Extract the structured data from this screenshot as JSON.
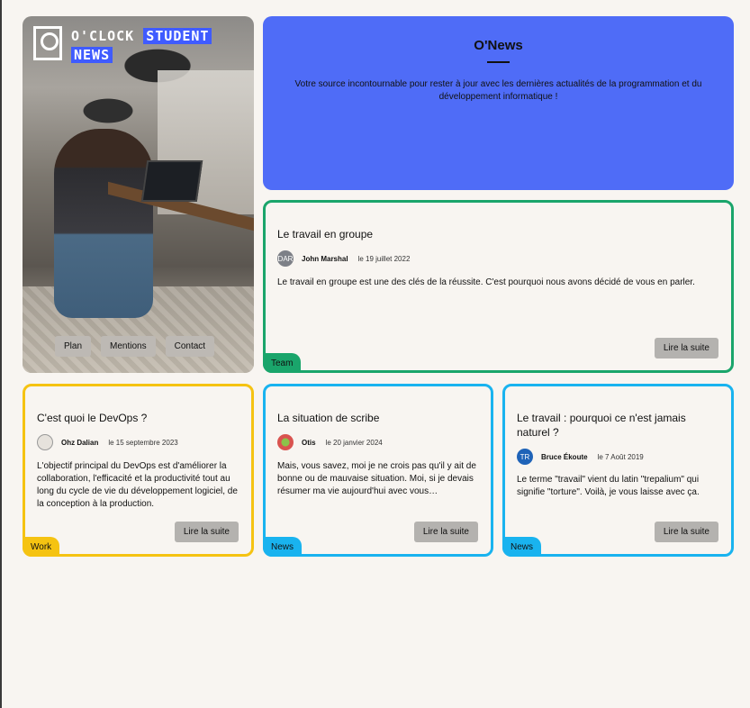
{
  "brand": {
    "line1_plain": "O'CLOCK",
    "line1_highlight": "STUDENT",
    "line2_highlight": "NEWS"
  },
  "nav": [
    "Plan",
    "Mentions",
    "Contact"
  ],
  "banner": {
    "title": "O'News",
    "description": "Votre source incontournable pour rester à jour avec les dernières actualités de la programmation et du développement informatique !"
  },
  "read_more_label": "Lire la suite",
  "colors": {
    "accent": "#4f6cf7",
    "team": "#1aa56b",
    "work": "#f5c312",
    "news": "#19b3ef"
  },
  "articles": [
    {
      "title": "Le travail en groupe",
      "avatar_initials": "DAR",
      "author": "John Marshal",
      "date": "le 19 juillet 2022",
      "excerpt": "Le travail en groupe est une des clés de la réussite. C'est pourquoi nous avons décidé de vous en parler.",
      "category": "Team"
    },
    {
      "title": "C'est quoi le DevOps ?",
      "avatar_initials": "",
      "author": "Ohz Dalian",
      "date": "le 15 septembre 2023",
      "excerpt": "L'objectif principal du DevOps est d'améliorer la collaboration, l'efficacité et la productivité tout au long du cycle de vie du développement logiciel, de la conception à la production.",
      "category": "Work"
    },
    {
      "title": "La situation de scribe",
      "avatar_initials": "",
      "author": "Otis",
      "date": "le 20 janvier 2024",
      "excerpt": "Mais, vous savez, moi je ne crois pas qu'il y ait de bonne ou de mauvaise situation. Moi, si je devais résumer ma vie aujourd'hui avec vous…",
      "category": "News"
    },
    {
      "title": "Le travail : pourquoi ce n'est jamais naturel ?",
      "avatar_initials": "TR",
      "author": "Bruce Ékoute",
      "date": "le 7 Août 2019",
      "excerpt": "Le terme \"travail\" vient du latin \"trepalium\" qui signifie \"torture\". Voilà, je vous laisse avec ça.",
      "category": "News"
    }
  ]
}
